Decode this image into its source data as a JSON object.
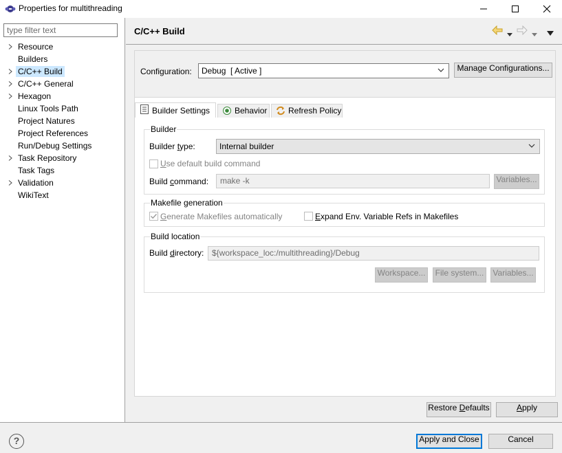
{
  "window": {
    "title": "Properties for multithreading",
    "icons": {
      "app": "eclipse-icon",
      "minimize": "minimize-icon",
      "maximize": "maximize-icon",
      "close": "close-icon"
    }
  },
  "sidebar": {
    "filter_placeholder": "type filter text",
    "items": [
      {
        "label": "Resource",
        "expandable": true
      },
      {
        "label": "Builders",
        "expandable": false
      },
      {
        "label": "C/C++ Build",
        "expandable": true,
        "selected": true
      },
      {
        "label": "C/C++ General",
        "expandable": true
      },
      {
        "label": "Hexagon",
        "expandable": true
      },
      {
        "label": "Linux Tools Path",
        "expandable": false
      },
      {
        "label": "Project Natures",
        "expandable": false
      },
      {
        "label": "Project References",
        "expandable": false
      },
      {
        "label": "Run/Debug Settings",
        "expandable": false
      },
      {
        "label": "Task Repository",
        "expandable": true
      },
      {
        "label": "Task Tags",
        "expandable": false
      },
      {
        "label": "Validation",
        "expandable": true
      },
      {
        "label": "WikiText",
        "expandable": false
      }
    ]
  },
  "page": {
    "title": "C/C++ Build",
    "configuration": {
      "label": "Configuration:",
      "value": "Debug  [ Active ]",
      "manage_button": "Manage Configurations..."
    },
    "tabs": [
      {
        "label": "Builder Settings",
        "icon": "settings-list-icon",
        "active": true
      },
      {
        "label": "Behavior",
        "icon": "radio-icon",
        "active": false
      },
      {
        "label": "Refresh Policy",
        "icon": "refresh-icon",
        "active": false
      }
    ],
    "builder": {
      "group_title": "Builder",
      "type_label_pre": "Builder ",
      "type_label_u": "t",
      "type_label_post": "ype:",
      "type_value": "Internal builder",
      "use_default_pre": "",
      "use_default_u": "U",
      "use_default_post": "se default build command",
      "command_label_pre": "Build ",
      "command_label_u": "c",
      "command_label_post": "ommand:",
      "command_value": "make -k",
      "variables_button": "Variables..."
    },
    "makefile": {
      "group_title": "Makefile generation",
      "generate_pre": "",
      "generate_u": "G",
      "generate_post": "enerate Makefiles automatically",
      "expand_pre": "",
      "expand_u": "E",
      "expand_post": "xpand Env. Variable Refs in Makefiles"
    },
    "location": {
      "group_title": "Build location",
      "dir_label_pre": "Build ",
      "dir_label_u": "d",
      "dir_label_post": "irectory:",
      "dir_value": "${workspace_loc:/multithreading}/Debug",
      "workspace_button": "Workspace...",
      "filesystem_button": "File system...",
      "variables_button": "Variables..."
    },
    "restore_pre": "Restore ",
    "restore_u": "D",
    "restore_post": "efaults",
    "apply_pre": "",
    "apply_u": "A",
    "apply_post": "pply"
  },
  "footer": {
    "help": "?",
    "apply_close": "Apply and Close",
    "cancel": "Cancel"
  }
}
